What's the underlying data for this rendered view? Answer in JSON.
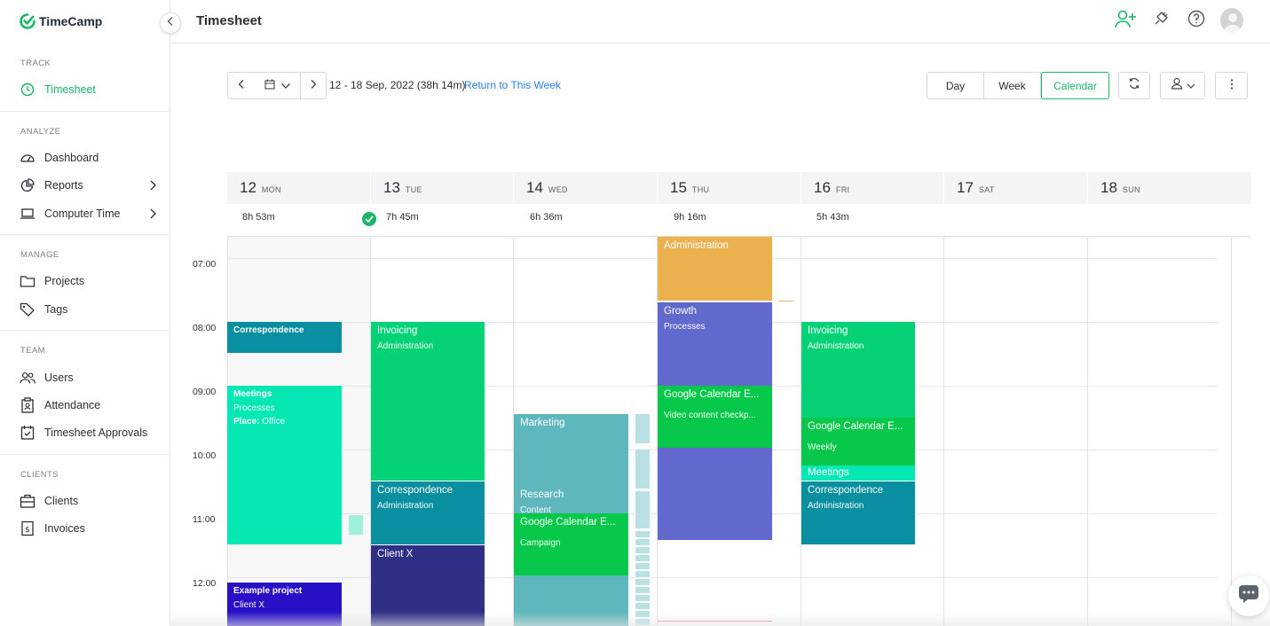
{
  "app": {
    "name": "TimeCamp",
    "brand_color": "#19b766"
  },
  "sidebar": {
    "sections": {
      "track": "TRACK",
      "analyze": "ANALYZE",
      "manage": "MANAGE",
      "team": "TEAM",
      "clients": "CLIENTS"
    },
    "items": {
      "timesheet": "Timesheet",
      "dashboard": "Dashboard",
      "reports": "Reports",
      "computer_time": "Computer Time",
      "projects": "Projects",
      "tags": "Tags",
      "users": "Users",
      "attendance": "Attendance",
      "timesheet_approvals": "Timesheet Approvals",
      "clients": "Clients",
      "invoices": "Invoices"
    }
  },
  "header": {
    "title": "Timesheet"
  },
  "toolbar": {
    "range": "12 - 18 Sep, 2022 (38h 14m)",
    "return_link": "Return to This Week",
    "views": {
      "day": "Day",
      "week": "Week",
      "calendar": "Calendar"
    },
    "active_view": "Calendar"
  },
  "days": [
    {
      "num": "12",
      "name": "MON",
      "total": "8h 53m"
    },
    {
      "num": "13",
      "name": "TUE",
      "total": "7h 45m"
    },
    {
      "num": "14",
      "name": "WED",
      "total": "6h 36m"
    },
    {
      "num": "15",
      "name": "THU",
      "total": "9h 16m"
    },
    {
      "num": "16",
      "name": "FRI",
      "total": "5h 43m"
    },
    {
      "num": "17",
      "name": "SAT",
      "total": ""
    },
    {
      "num": "18",
      "name": "SUN",
      "total": ""
    }
  ],
  "hours": [
    "07:00",
    "08:00",
    "09:00",
    "10:00",
    "11:00",
    "12:00"
  ],
  "events": {
    "mon_correspondence": {
      "title": "Correspondence"
    },
    "mon_meetings": {
      "title": "Meetings",
      "sub": "Processes",
      "place_label": "Place:",
      "place": "Office"
    },
    "mon_example": {
      "title": "Example project",
      "sub": "Client X"
    },
    "tue_invoicing": {
      "title": "Invoicing",
      "sub": "Administration"
    },
    "tue_correspondence": {
      "title": "Correspondence",
      "sub": "Administration"
    },
    "tue_client": {
      "title": "Client X"
    },
    "wed_marketing": {
      "title": "Marketing"
    },
    "wed_research": {
      "title": "Research",
      "sub": "Content"
    },
    "wed_gcal": {
      "title": "Google Calendar E...",
      "sub": "Campaign"
    },
    "thu_admin": {
      "title": "Administration"
    },
    "thu_growth": {
      "title": "Growth",
      "sub": "Processes"
    },
    "thu_gcal": {
      "title": "Google Calendar E...",
      "sub": "Video content checkp..."
    },
    "fri_invoicing": {
      "title": "Invoicing",
      "sub": "Administration"
    },
    "fri_gcal": {
      "title": "Google Calendar E...",
      "sub": "Weekly"
    },
    "fri_meetings": {
      "title": "Meetings"
    },
    "fri_correspondence": {
      "title": "Correspondence",
      "sub": "Administration"
    }
  },
  "colors": {
    "teal_dark": "#0a8fa0",
    "mint": "#05e8b4",
    "green": "#05d277",
    "green_strong": "#07c84a",
    "navy": "#2e2f85",
    "indigo": "#2810c6",
    "teal_soft": "#5eb7bc",
    "orange": "#ebb14f",
    "purple": "#6269cc"
  }
}
